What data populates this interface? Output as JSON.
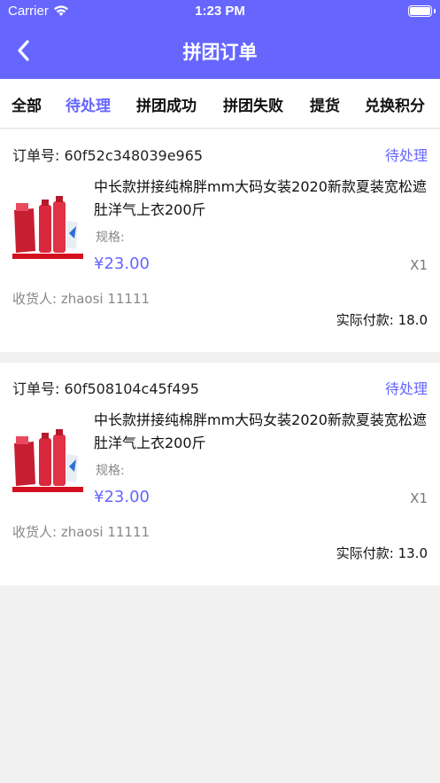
{
  "status_bar": {
    "carrier": "Carrier",
    "time": "1:23 PM"
  },
  "nav": {
    "title": "拼团订单",
    "back_icon": "chevron-left-icon"
  },
  "tabs": [
    {
      "label": "全部",
      "active": false
    },
    {
      "label": "待处理",
      "active": true
    },
    {
      "label": "拼团成功",
      "active": false
    },
    {
      "label": "拼团失败",
      "active": false
    },
    {
      "label": "提货",
      "active": false
    },
    {
      "label": "兑换积分",
      "active": false
    }
  ],
  "orders": [
    {
      "order_no": "订单号: 60f52c348039e965",
      "status": "待处理",
      "product_name": "中长款拼接纯棉胖mm大码女装2020新款夏装宽松遮肚洋气上衣200斤",
      "spec": "规格:",
      "price": "¥23.00",
      "qty": "X1",
      "receiver": "收货人: zhaosi    11111",
      "paid": "实际付款: 18.0"
    },
    {
      "order_no": "订单号: 60f508104c45f495",
      "status": "待处理",
      "product_name": "中长款拼接纯棉胖mm大码女装2020新款夏装宽松遮肚洋气上衣200斤",
      "spec": "规格:",
      "price": "¥23.00",
      "qty": "X1",
      "receiver": "收货人: zhaosi    11111",
      "paid": "实际付款: 13.0"
    }
  ],
  "colors": {
    "accent": "#6666ff",
    "background": "#f1f1f1"
  }
}
